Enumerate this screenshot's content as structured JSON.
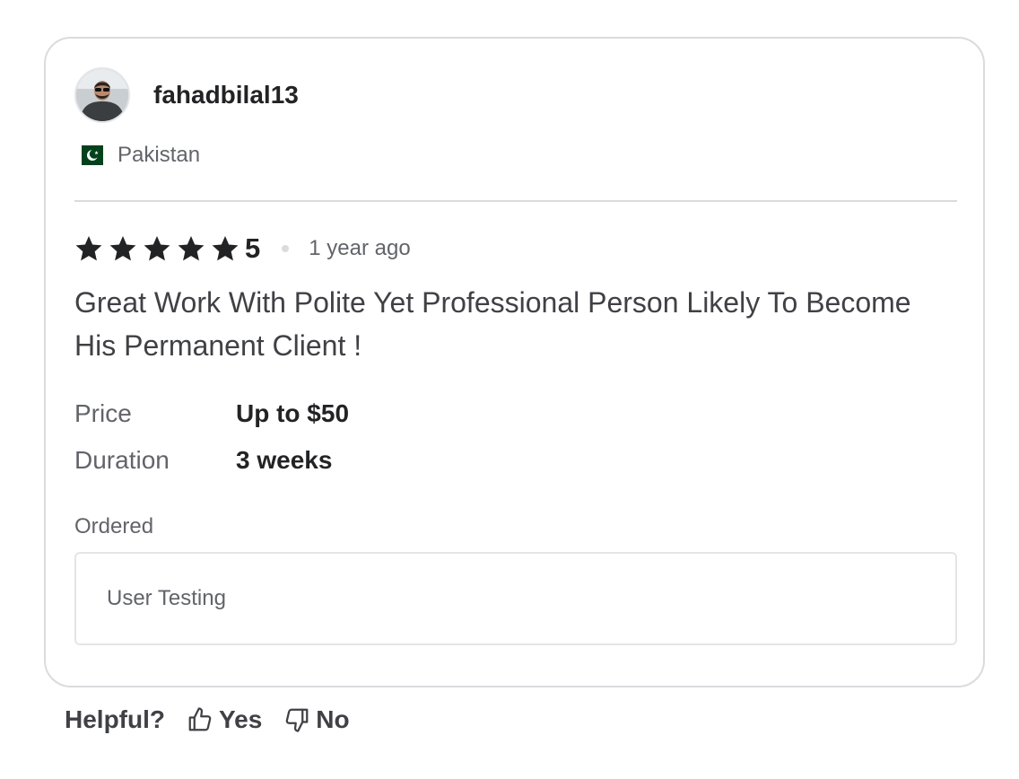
{
  "reviewer": {
    "username": "fahadbilal13",
    "country": "Pakistan",
    "flag_icon": "pakistan-flag-icon"
  },
  "review": {
    "rating": 5,
    "rating_label": "5",
    "star_color": "#222325",
    "time_ago": "1 year ago",
    "text": "Great Work With Polite Yet Professional Person Likely To Become His Permanent Client !"
  },
  "details": {
    "price_label": "Price",
    "price_value": "Up to $50",
    "duration_label": "Duration",
    "duration_value": "3 weeks"
  },
  "ordered": {
    "label": "Ordered",
    "item": "User Testing"
  },
  "helpful": {
    "question": "Helpful?",
    "yes_label": "Yes",
    "no_label": "No",
    "yes_icon": "thumbs-up-icon",
    "no_icon": "thumbs-down-icon"
  }
}
